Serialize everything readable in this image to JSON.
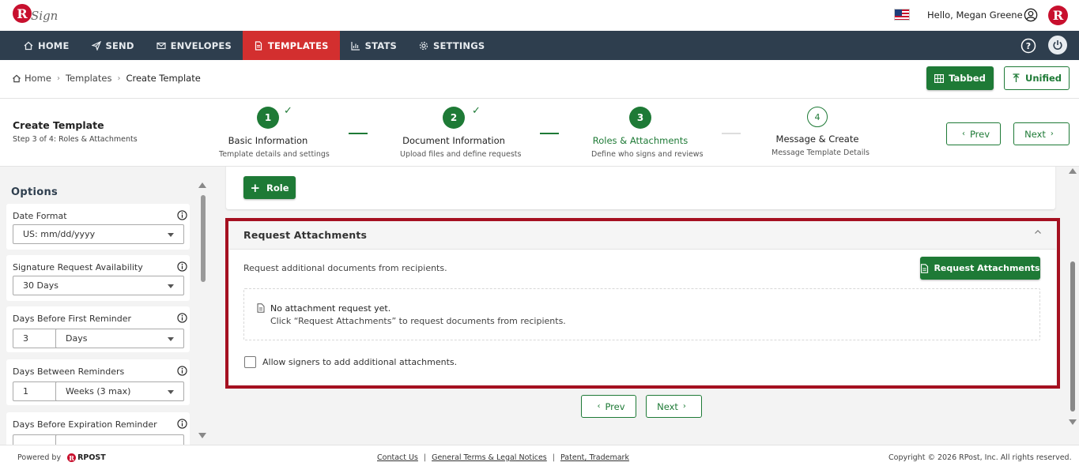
{
  "brand": {
    "logo_letter": "R",
    "logo_word": "Sign",
    "accent": "#c8102e",
    "nav_bg": "#2e3e4e",
    "green": "#1e7a36"
  },
  "header": {
    "greeting": "Hello, Megan Greene",
    "avatar_letter": "R"
  },
  "nav": {
    "items": [
      {
        "label": "HOME",
        "icon": "home-icon"
      },
      {
        "label": "SEND",
        "icon": "send-icon"
      },
      {
        "label": "ENVELOPES",
        "icon": "envelope-icon"
      },
      {
        "label": "TEMPLATES",
        "icon": "document-icon",
        "active": true
      },
      {
        "label": "STATS",
        "icon": "bar-chart-icon"
      },
      {
        "label": "SETTINGS",
        "icon": "gear-icon"
      }
    ]
  },
  "breadcrumb": {
    "home": "Home",
    "templates": "Templates",
    "current": "Create Template"
  },
  "view_toggle": {
    "tabbed": "Tabbed",
    "unified": "Unified"
  },
  "wizard": {
    "title": "Create Template",
    "subtitle": "Step 3 of 4: Roles & Attachments",
    "steps": [
      {
        "num": "1",
        "title": "Basic Information",
        "desc": "Template details and settings",
        "status": "done"
      },
      {
        "num": "2",
        "title": "Document Information",
        "desc": "Upload files and define requests",
        "status": "done"
      },
      {
        "num": "3",
        "title": "Roles & Attachments",
        "desc": "Define who signs and reviews",
        "status": "current"
      },
      {
        "num": "4",
        "title": "Message & Create",
        "desc": "Message Template Details",
        "status": "pending"
      }
    ],
    "prev": "Prev",
    "next": "Next"
  },
  "options": {
    "title": "Options",
    "date_format": {
      "label": "Date Format",
      "value": "US: mm/dd/yyyy"
    },
    "availability": {
      "label": "Signature Request Availability",
      "value": "30 Days"
    },
    "first_reminder": {
      "label": "Days Before First Reminder",
      "number": "3",
      "unit": "Days"
    },
    "between_reminders": {
      "label": "Days Between Reminders",
      "number": "1",
      "unit": "Weeks (3 max)"
    },
    "expiration_reminder": {
      "label": "Days Before Expiration Reminder"
    }
  },
  "roles": {
    "add_role": "Role"
  },
  "attachments": {
    "title": "Request Attachments",
    "description": "Request additional documents from recipients.",
    "button": "Request Attachments",
    "empty_title": "No attachment request yet.",
    "empty_hint": "Click “Request Attachments” to request documents from recipients.",
    "allow_label": "Allow signers to add additional attachments.",
    "allow_checked": false
  },
  "bottom_nav": {
    "prev": "Prev",
    "next": "Next"
  },
  "footer": {
    "powered_by": "Powered by",
    "rpost": "RPOST",
    "links": [
      "Contact Us",
      "General Terms & Legal Notices",
      "Patent, Trademark"
    ],
    "copyright": "Copyright © 2026 RPost, Inc. All rights reserved."
  }
}
